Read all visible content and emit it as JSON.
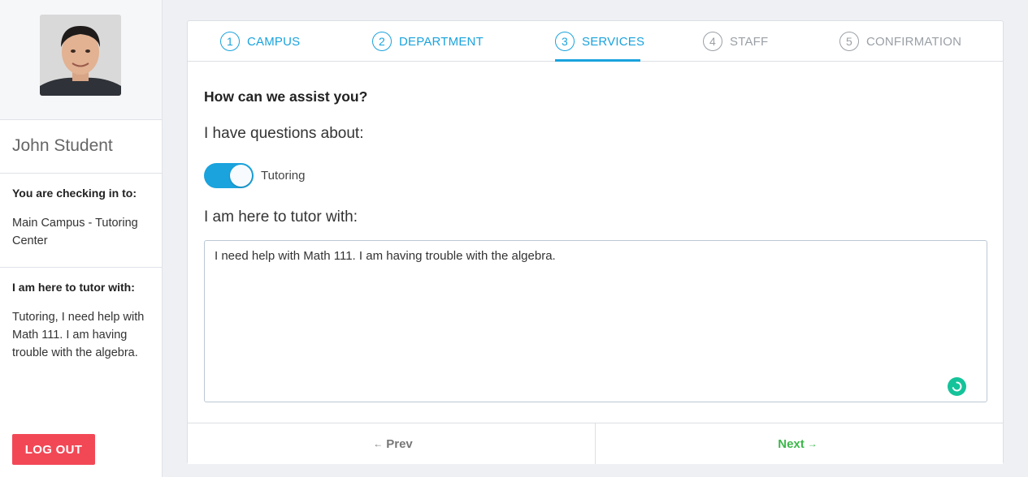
{
  "sidebar": {
    "student_name": "John Student",
    "checking_in_heading": "You are checking in to:",
    "checking_in_value": "Main Campus - Tutoring Center",
    "tutor_heading": "I am here to tutor with:",
    "tutor_value": "Tutoring, I need help with Math 111. I am having trouble with the algebra.",
    "logout_label": "LOG OUT"
  },
  "steps": [
    {
      "number": "1",
      "label": "CAMPUS",
      "state": "done"
    },
    {
      "number": "2",
      "label": "DEPARTMENT",
      "state": "done"
    },
    {
      "number": "3",
      "label": "SERVICES",
      "state": "active"
    },
    {
      "number": "4",
      "label": "STAFF",
      "state": "pending"
    },
    {
      "number": "5",
      "label": "CONFIRMATION",
      "state": "pending"
    }
  ],
  "form": {
    "title": "How can we assist you?",
    "questions_label": "I have questions about:",
    "toggle_label": "Tutoring",
    "toggle_on": true,
    "tutor_label": "I am here to tutor with:",
    "tutor_text": "I need help with Math 111. I am having trouble with the algebra."
  },
  "footer": {
    "prev_label": "Prev",
    "next_label": "Next"
  },
  "colors": {
    "accent": "#1aa3dd",
    "logout": "#f24856",
    "next": "#3cb84a",
    "grammar": "#15c39a"
  }
}
